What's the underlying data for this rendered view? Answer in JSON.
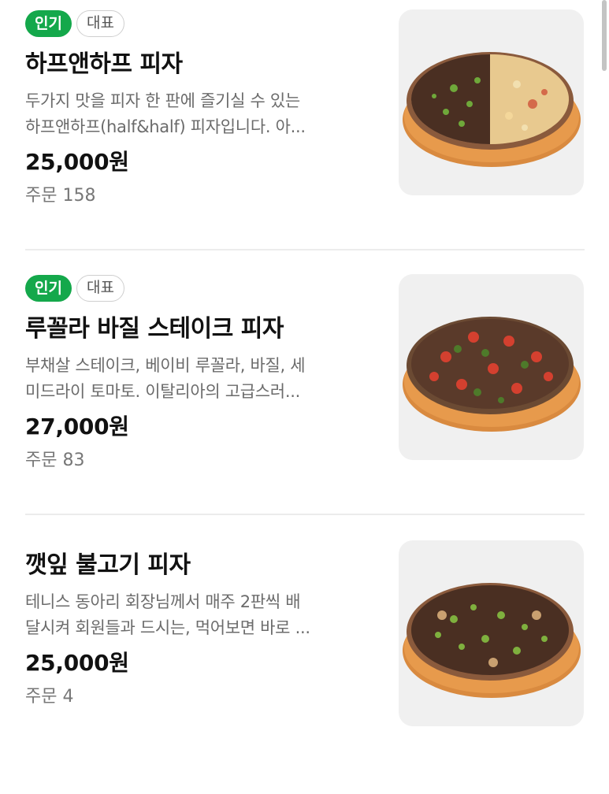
{
  "items": [
    {
      "badges": {
        "popular": "인기",
        "representative": "대표"
      },
      "name": "하프앤하프 피자",
      "desc_line1": "두가지 맛을 피자 한 판에 즐기실 수 있는",
      "desc_line2": "하프앤하프(half&half) 피자입니다. 아...",
      "price": "25,000원",
      "orders": "주문 158",
      "image_icon": "pizza-half-and-half-photo"
    },
    {
      "badges": {
        "popular": "인기",
        "representative": "대표"
      },
      "name": "루꼴라 바질 스테이크 피자",
      "desc_line1": "부채살 스테이크, 베이비 루꼴라, 바질, 세",
      "desc_line2": "미드라이 토마토. 이탈리아의 고급스러...",
      "price": "27,000원",
      "orders": "주문 83",
      "image_icon": "pizza-arugula-steak-photo"
    },
    {
      "name": "깻잎 불고기 피자",
      "desc_line1": "테니스 동아리 회장님께서 매주 2판씩 배",
      "desc_line2": "달시켜 회원들과 드시는, 먹어보면 바로 ...",
      "price": "25,000원",
      "orders": "주문 4",
      "image_icon": "pizza-bulgogi-photo"
    }
  ],
  "colors": {
    "popular_badge": "#14a84b",
    "thumb_bg": "#f0f0f0",
    "divider": "#ececec"
  }
}
